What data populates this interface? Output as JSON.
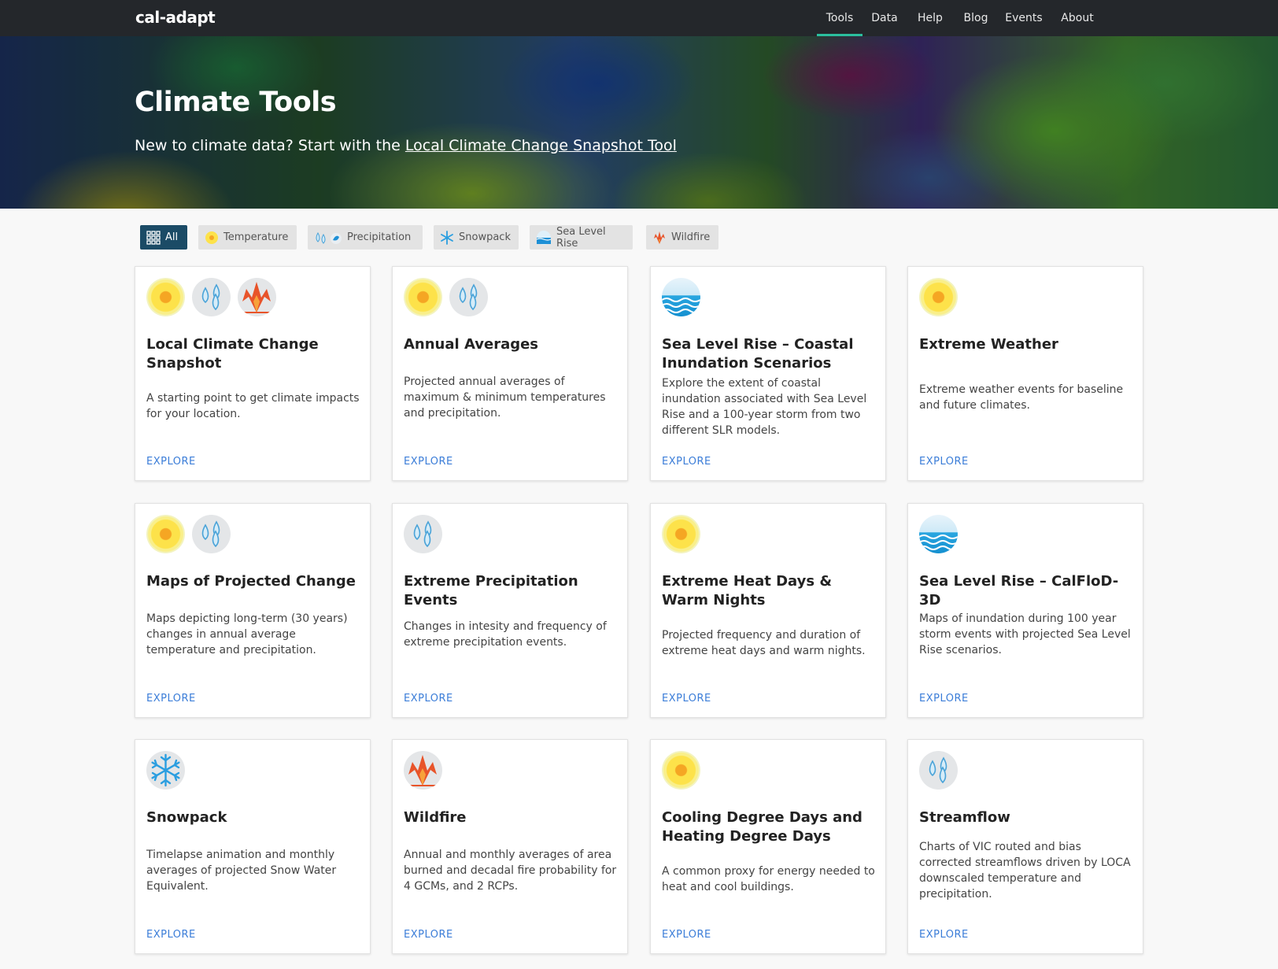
{
  "nav": {
    "logo": "cal-adapt",
    "items": [
      {
        "label": "Tools",
        "active": true
      },
      {
        "label": "Data",
        "active": false
      },
      {
        "label": "Help",
        "active": false
      },
      {
        "label": "Blog",
        "active": false
      },
      {
        "label": "Events",
        "active": false
      },
      {
        "label": "About",
        "active": false
      }
    ],
    "accent_color": "#2bbf9e"
  },
  "hero": {
    "title": "Climate Tools",
    "subtitle_prefix": "New to climate data? Start with the ",
    "subtitle_link": "Local Climate Change Snapshot Tool"
  },
  "filters": [
    {
      "label": "All",
      "icon": "grid-icon",
      "active": true
    },
    {
      "label": "Temperature",
      "icon": "sun-icon",
      "active": false
    },
    {
      "label": "Precipitation",
      "icon": "raindrops-icon",
      "active": false
    },
    {
      "label": "Snowpack",
      "icon": "snowflake-icon",
      "active": false
    },
    {
      "label": "Sea Level Rise",
      "icon": "wave-icon",
      "active": false
    },
    {
      "label": "Wildfire",
      "icon": "fire-icon",
      "active": false
    }
  ],
  "cards": [
    {
      "title": "Local Climate Change Snapshot",
      "description": "A starting point to get climate impacts for your location.",
      "icons": [
        "sun-icon",
        "raindrops-icon",
        "fire-icon"
      ],
      "link": "EXPLORE"
    },
    {
      "title": "Annual Averages",
      "description": "Projected annual averages of maximum & minimum temperatures and precipitation.",
      "icons": [
        "sun-icon",
        "raindrops-icon"
      ],
      "link": "EXPLORE"
    },
    {
      "title": "Sea Level Rise – Coastal Inundation Scenarios",
      "description": "Explore the extent of coastal inundation associated with Sea Level Rise and a 100-year storm from two different SLR models.",
      "icons": [
        "wave-icon"
      ],
      "link": "EXPLORE"
    },
    {
      "title": "Extreme Weather",
      "description": "Extreme weather events for baseline and future climates.",
      "icons": [
        "sun-icon"
      ],
      "link": "EXPLORE"
    },
    {
      "title": "Maps of Projected Change",
      "description": "Maps depicting long-term (30 years) changes in annual average temperature and precipitation.",
      "icons": [
        "sun-icon",
        "raindrops-icon"
      ],
      "link": "EXPLORE"
    },
    {
      "title": "Extreme Precipitation Events",
      "description": "Changes in intesity and frequency of extreme precipitation events.",
      "icons": [
        "raindrops-icon"
      ],
      "link": "EXPLORE"
    },
    {
      "title": "Extreme Heat Days & Warm Nights",
      "description": "Projected frequency and duration of extreme heat days and warm nights.",
      "icons": [
        "sun-icon"
      ],
      "link": "EXPLORE"
    },
    {
      "title": "Sea Level Rise – CalFloD-3D",
      "description": "Maps of inundation during 100 year storm events with projected Sea Level Rise scenarios.",
      "icons": [
        "wave-icon"
      ],
      "link": "EXPLORE"
    },
    {
      "title": "Snowpack",
      "description": "Timelapse animation and monthly averages of projected Snow Water Equivalent.",
      "icons": [
        "snowflake-icon"
      ],
      "link": "EXPLORE"
    },
    {
      "title": "Wildfire",
      "description": "Annual and monthly averages of area burned and decadal fire probability for 4 GCMs, and 2 RCPs.",
      "icons": [
        "fire-icon"
      ],
      "link": "EXPLORE"
    },
    {
      "title": "Cooling Degree Days and Heating Degree Days",
      "description": "A common proxy for energy needed to heat and cool buildings.",
      "icons": [
        "sun-icon"
      ],
      "link": "EXPLORE"
    },
    {
      "title": "Streamflow",
      "description": "Charts of VIC routed and bias corrected streamflows driven by LOCA downscaled temperature and precipitation.",
      "icons": [
        "raindrops-icon"
      ],
      "link": "EXPLORE"
    }
  ],
  "colors": {
    "navbar": "#24272b",
    "active_filter": "#1b4b66",
    "link": "#3b7dd8"
  }
}
